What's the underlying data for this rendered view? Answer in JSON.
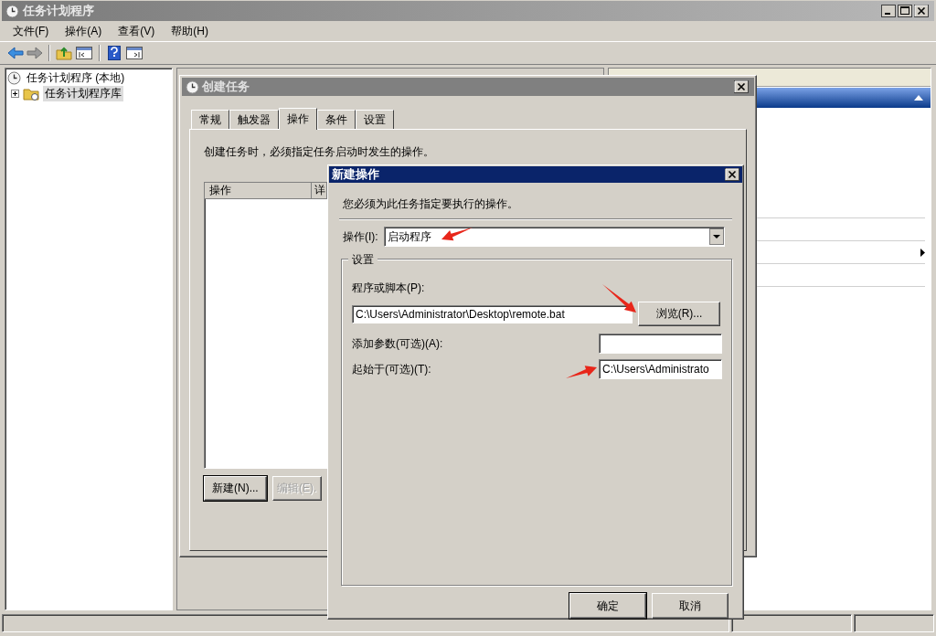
{
  "window": {
    "title": "任务计划程序"
  },
  "menu": [
    "文件(F)",
    "操作(A)",
    "查看(V)",
    "帮助(H)"
  ],
  "tree": [
    {
      "label": "任务计划程序 (本地)",
      "selected": false,
      "children": [
        {
          "label": "任务计划程序库",
          "selected": true,
          "expanded": false
        }
      ]
    }
  ],
  "create_task_dialog": {
    "title": "创建任务",
    "tabs": [
      {
        "label": "常规",
        "selected": false
      },
      {
        "label": "触发器",
        "selected": false
      },
      {
        "label": "操作",
        "selected": true
      },
      {
        "label": "条件",
        "selected": false
      },
      {
        "label": "设置",
        "selected": false
      }
    ],
    "description": "创建任务时，必须指定任务启动时发生的操作。",
    "actions_table": {
      "columns": [
        "操作",
        "详"
      ]
    },
    "buttons": [
      {
        "label": "新建(N)...",
        "disabled": false
      },
      {
        "label": "编辑(E).",
        "disabled": true
      }
    ]
  },
  "new_action_dialog": {
    "title": "新建操作",
    "description": "您必须为此任务指定要执行的操作。",
    "action": {
      "label": "操作(I):",
      "value": "启动程序"
    },
    "settings": {
      "title": "设置",
      "program": {
        "label": "程序或脚本(P):",
        "value": "C:\\Users\\Administrator\\Desktop\\remote.bat"
      },
      "browse_button": "浏览(R)...",
      "arguments": {
        "label": "添加参数(可选)(A):"
      },
      "start_in": {
        "label": "起始于(可选)(T):",
        "value": "C:\\Users\\Administrato"
      }
    },
    "buttons": [
      {
        "label": "确定",
        "default": true
      },
      {
        "label": "取消",
        "default": false
      }
    ]
  }
}
